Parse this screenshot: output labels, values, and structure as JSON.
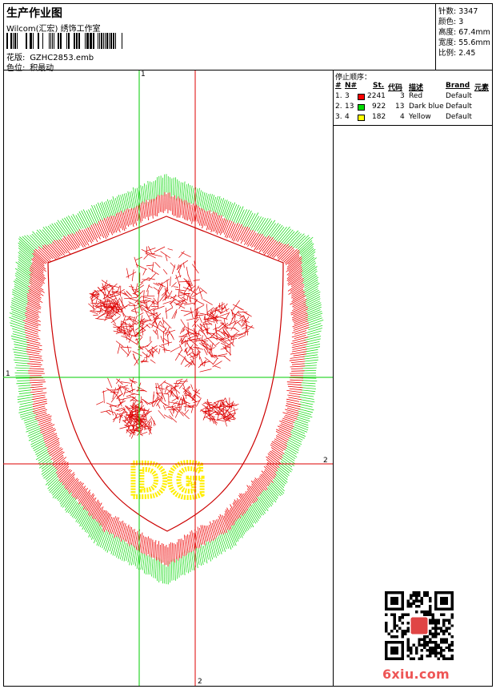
{
  "header": {
    "title": "生产作业图",
    "company": "Wilcom(汇宏) 绣饰工作室",
    "design_label": "花版:",
    "design_value": "GZHC2853.emb",
    "colorway_label": "色位:",
    "colorway_value": "积最动"
  },
  "stats": {
    "stitches": "针数: 3347",
    "colors": "颜色: 3",
    "height": "高度: 67.4mm",
    "width": "宽度: 55.6mm",
    "scale": "比例: 2.45"
  },
  "stop_sequence": {
    "title": "停止顺序：",
    "headers": {
      "num": "#",
      "needle": "N#",
      "st": "St.",
      "code": "代码",
      "desc": "描述",
      "brand": "Brand",
      "element": "元素"
    },
    "rows": [
      {
        "idx": "1.",
        "needle": "3",
        "stitches": "2241",
        "code": "3",
        "desc": "Red",
        "brand": "Default",
        "color": "#ff0000"
      },
      {
        "idx": "2.",
        "needle": "13",
        "stitches": "922",
        "code": "13",
        "desc": "Dark blue",
        "brand": "Default",
        "color": "#00dd00"
      },
      {
        "idx": "3.",
        "needle": "4",
        "stitches": "182",
        "code": "4",
        "desc": "Yellow",
        "brand": "Default",
        "color": "#ffff00"
      }
    ]
  },
  "guides": {
    "v1": "1",
    "h1": "1",
    "h2": "2",
    "v2": "2"
  },
  "badge_letters": "DG",
  "watermark": "6xiu.com"
}
